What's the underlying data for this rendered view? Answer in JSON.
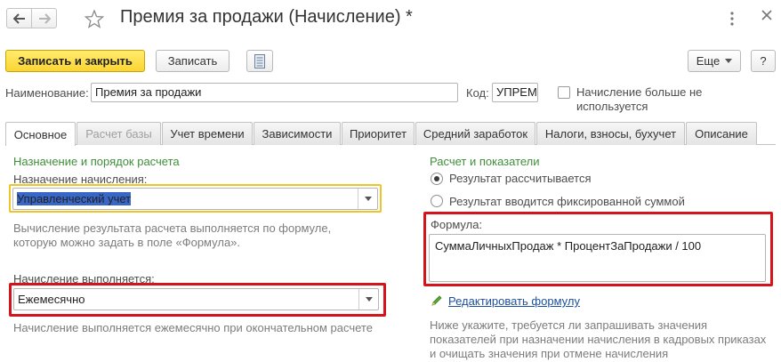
{
  "header": {
    "title": "Премия за продажи (Начисление) *"
  },
  "toolbar": {
    "save_close_label": "Записать и закрыть",
    "save_label": "Записать",
    "more_label": "Еще",
    "help_label": "?"
  },
  "form": {
    "name_label": "Наименование:",
    "name_value": "Премия за продажи",
    "code_label": "Код:",
    "code_value": "УПРЕМ",
    "unused_label_line1": "Начисление больше не",
    "unused_label_line2": "используется"
  },
  "tabs": [
    {
      "label": "Основное"
    },
    {
      "label": "Расчет базы"
    },
    {
      "label": "Учет времени"
    },
    {
      "label": "Зависимости"
    },
    {
      "label": "Приоритет"
    },
    {
      "label": "Средний заработок"
    },
    {
      "label": "Налоги, взносы, бухучет"
    },
    {
      "label": "Описание"
    }
  ],
  "left": {
    "group_title": "Назначение и порядок расчета",
    "purpose_label": "Назначение начисления:",
    "purpose_value": "Управленческий учет",
    "purpose_hint_line1": "Вычисление результата расчета выполняется по формуле,",
    "purpose_hint_line2": "которую можно задать в поле «Формула».",
    "schedule_label": "Начисление выполняется:",
    "schedule_value": "Ежемесячно",
    "schedule_hint": "Начисление выполняется ежемесячно при окончательном расчете"
  },
  "right": {
    "group_title": "Расчет и показатели",
    "radio_calculated": "Результат рассчитывается",
    "radio_fixed": "Результат вводится фиксированной суммой",
    "formula_label": "Формула:",
    "formula_value": "СуммаЛичныхПродаж * ПроцентЗаПродажи / 100",
    "edit_formula_link": "Редактировать формулу",
    "bottom_hint_line1": "Ниже укажите, требуется ли запрашивать значения",
    "bottom_hint_line2": "показателей при назначении начисления в кадровых приказах",
    "bottom_hint_line3": "и очищать значения при отмене начисления"
  },
  "colors": {
    "accent_yellow": "#fbd532",
    "group_green": "#3f8e3a",
    "highlight_red": "#d3141b",
    "link_blue": "#1c4f9c"
  }
}
